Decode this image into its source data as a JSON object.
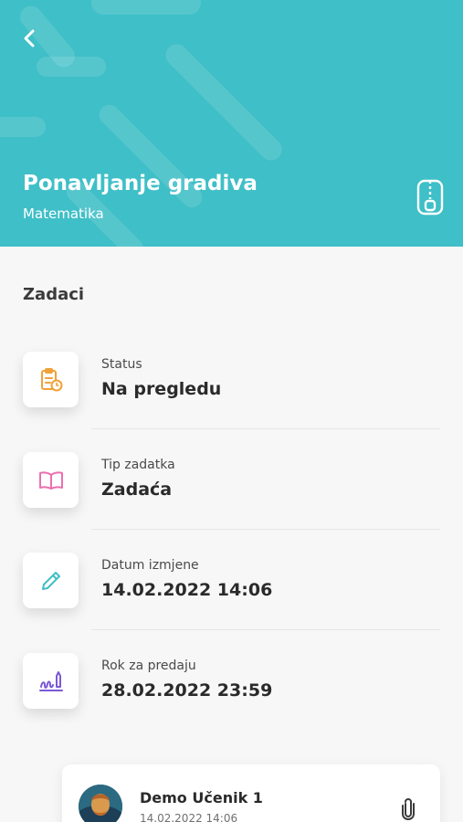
{
  "header": {
    "title": "Ponavljanje gradiva",
    "subject": "Matematika",
    "background_color": "#3fbfc7"
  },
  "section": {
    "title": "Zadaci"
  },
  "details": [
    {
      "label": "Status",
      "value": "Na pregledu",
      "icon": "clipboard-clock-icon",
      "icon_color": "#f0a23a"
    },
    {
      "label": "Tip zadatka",
      "value": "Zadaća",
      "icon": "open-book-icon",
      "icon_color": "#ec6fb0"
    },
    {
      "label": "Datum izmjene",
      "value": "14.02.2022 14:06",
      "icon": "pencil-icon",
      "icon_color": "#3fbfc7"
    },
    {
      "label": "Rok za predaju",
      "value": "28.02.2022 23:59",
      "icon": "signature-icon",
      "icon_color": "#7a5ad6"
    }
  ],
  "submission": {
    "student_name": "Demo Učenik 1",
    "date": "14.02.2022 14:06",
    "attachment_icon": "paperclip-icon"
  },
  "icons": {
    "back": "chevron-left-icon",
    "archive": "zip-file-icon"
  }
}
